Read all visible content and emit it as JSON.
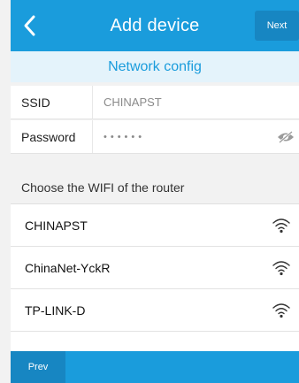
{
  "header": {
    "back_icon": "chevron-left-icon",
    "title": "Add device",
    "next_label": "Next"
  },
  "subheader": {
    "title": "Network config"
  },
  "form": {
    "ssid_label": "SSID",
    "ssid_value": "CHINAPST",
    "password_label": "Password",
    "password_value": "••••••",
    "visibility_icon": "eye-off-icon"
  },
  "wifi": {
    "section_label": "Choose the WIFI of the router",
    "networks": [
      {
        "name": "CHINAPST",
        "icon": "wifi-icon"
      },
      {
        "name": "ChinaNet-YckR",
        "icon": "wifi-icon"
      },
      {
        "name": "TP-LINK-D",
        "icon": "wifi-icon"
      }
    ]
  },
  "footer": {
    "prev_label": "Prev"
  },
  "colors": {
    "primary": "#1a9cdc",
    "primary_dark": "#1786c2",
    "subheader_bg": "#e4f3fb"
  }
}
